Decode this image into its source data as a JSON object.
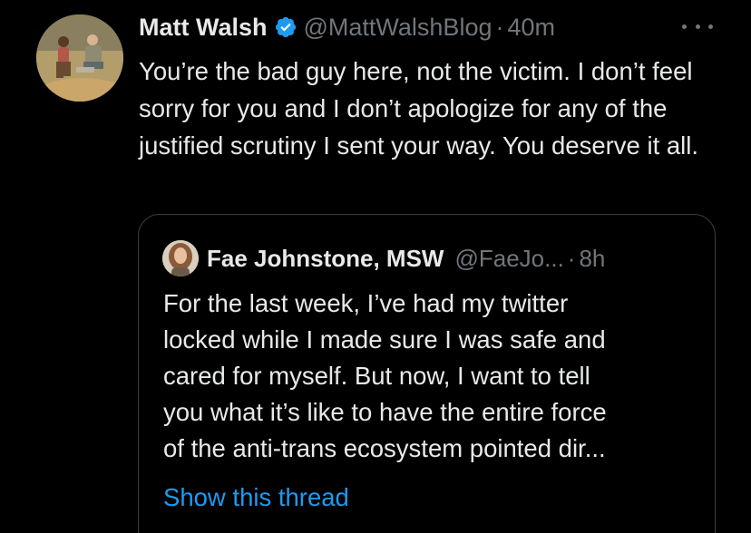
{
  "tweet": {
    "author_name": "Matt Walsh",
    "handle": "@MattWalshBlog",
    "separator": "·",
    "time": "40m",
    "body": "You’re the bad guy here, not the victim. I don’t feel sorry for you and I don’t apologize for any of the justified scrutiny I sent your way. You deserve it all.",
    "more_icon": "more-horizontal-icon",
    "verified_icon": "verified-badge-icon",
    "verified_color": "#1d9bf0"
  },
  "quote": {
    "author_name": "Fae Johnstone, MSW",
    "handle": "@FaeJo...",
    "separator": "·",
    "time": "8h",
    "lines": [
      "For the last week, I’ve had my twitter",
      "locked while I made sure I was safe and",
      "cared for myself. But now, I want to tell",
      "you what it’s like to have the entire force",
      "of the anti-trans ecosystem pointed dir..."
    ],
    "show_thread_label": "Show this thread",
    "link_color": "#1d9bf0"
  }
}
